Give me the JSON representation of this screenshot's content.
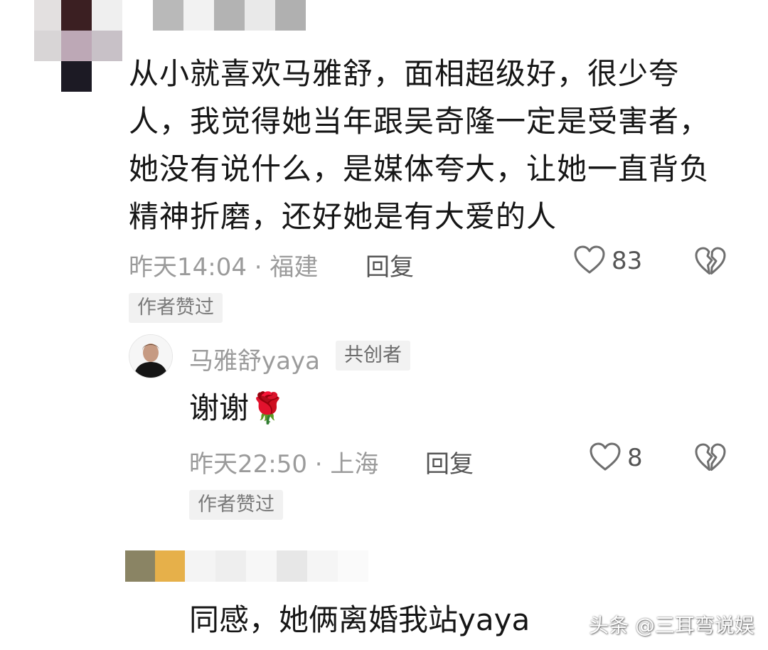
{
  "comment": {
    "text": "从小就喜欢马雅舒，面相超级好，很少夸人，我觉得她当年跟吴奇隆一定是受害者，她没有说什么，是媒体夸大，让她一直背负精神折磨，还好她是有大爱的人",
    "time_location": "昨天14:04 · 福建",
    "reply_label": "回复",
    "like_count": "83",
    "author_liked_badge": "作者赞过"
  },
  "reply": {
    "username": "马雅舒yaya",
    "role_badge": "共创者",
    "text": "谢谢",
    "emoji": "🌹",
    "time_location": "昨天22:50 · 上海",
    "reply_label": "回复",
    "like_count": "8",
    "author_liked_badge": "作者赞过"
  },
  "next_comment": {
    "text": "同感，她俩离婚我站yaya"
  },
  "watermark": "头条 @三耳弯说娱",
  "icons": {
    "like": "heart-outline-icon",
    "dislike": "broken-heart-icon",
    "rose": "rose-emoji-icon"
  },
  "colors": {
    "text_primary": "#161616",
    "text_meta": "#9b9b9b",
    "badge_bg": "#f1f1f1"
  }
}
